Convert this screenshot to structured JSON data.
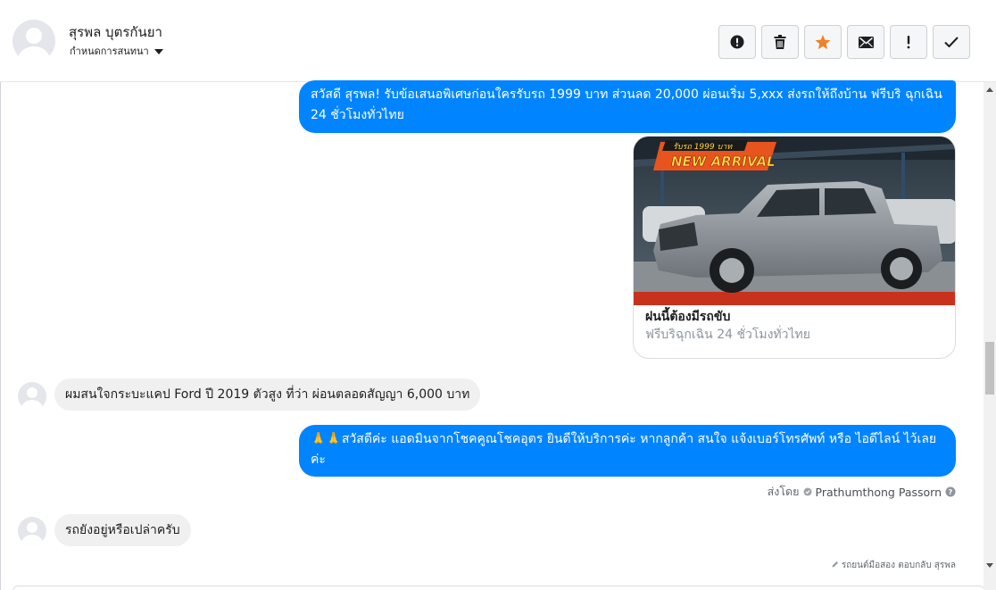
{
  "contact": {
    "name": "สุรพล บุตรกันยา",
    "status_dropdown": "กำหนดการสนทนา"
  },
  "toolbar": {
    "buttons": [
      {
        "icon": "alert-circle-icon",
        "title": "spam"
      },
      {
        "icon": "trash-icon",
        "title": "delete"
      },
      {
        "icon": "star-icon",
        "title": "star",
        "color": "#f0812b"
      },
      {
        "icon": "envelope-icon",
        "title": "mark unread"
      },
      {
        "icon": "exclamation-icon",
        "title": "follow up"
      },
      {
        "icon": "check-icon",
        "title": "done"
      }
    ]
  },
  "messages": [
    {
      "direction": "outgoing",
      "text": "สวัสดี สุรพล! รับข้อเสนอพิเศษก่อนใครรับรถ 1999 บาท ส่วนลด 20,000 ผ่อนเริ่ม 5,xxx ส่งรถให้ถึงบ้าน ฟรีบริ ฉุกเฉิน 24 ชั่วโมงทั่วไทย"
    },
    {
      "direction": "outgoing",
      "type": "card",
      "image_banner_top": "รับรถ 1999 บาท",
      "image_banner_main": "NEW ARRIVAL",
      "title": "ฝนนี้ต้องมีรถขับ",
      "subtitle": "ฟรีบริฉุกเฉิน 24 ชั่วโมงทั่วไทย"
    },
    {
      "direction": "incoming",
      "text": "ผมสนใจกระบะแคป Ford ปี 2019 ตัวสูง ที่ว่า ผ่อนตลอดสัญญา 6,000 บาท"
    },
    {
      "direction": "outgoing",
      "text": "🙏🙏สวัสดีค่ะ แอดมินจากโชคคูณโชคอุตร ยินดีให้บริการค่ะ หากลูกค้า สนใจ แจ้งเบอร์โทรศัพท์ หรือ ไอดีไลน์ ไว้เลยค่ะ"
    },
    {
      "direction": "incoming",
      "text": "รถยังอยู่หรือเปล่าครับ"
    }
  ],
  "sent_by": {
    "prefix": "ส่งโดย",
    "name": "Prathumthong Passorn"
  },
  "footnote": "รถยนต์มือสอง ตอบกลับ สุรพล",
  "colors": {
    "outgoing_bubble": "#0084ff",
    "incoming_bubble": "#f0f0f0",
    "star_active": "#f0812b"
  }
}
